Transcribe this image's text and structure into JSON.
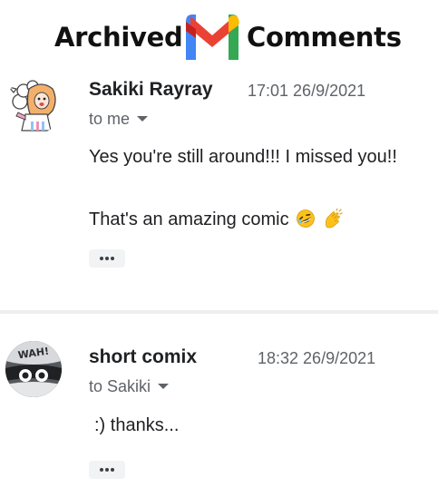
{
  "header": {
    "word_left": "Archived",
    "word_right": "Comments",
    "logo_icon": "gmail-m-logo",
    "logo_colors": [
      "#4285F4",
      "#EA4335",
      "#FBBC04",
      "#34A853",
      "#C5221F"
    ]
  },
  "messages": [
    {
      "sender": "Sakiki Rayray",
      "time": "17:01 26/9/2021",
      "recipient": "to me",
      "avatar_icon": "alpaca-with-hijab-avatar",
      "lines": [
        "Yes you're still around!!! I missed you!!",
        "That's an amazing comic"
      ],
      "emojis": [
        "rolling-on-floor-laughing-emoji",
        "clapping-hands-emoji"
      ]
    },
    {
      "sender": "short comix",
      "time": "18:32 26/9/2021",
      "recipient": "to Sakiki",
      "avatar_icon": "raccoon-mask-avatar",
      "avatar_text": "WAH!",
      "lines": [
        ":) thanks..."
      ]
    }
  ],
  "colors": {
    "sender_text": "#202124",
    "meta_text": "#5f6368",
    "more_button_bg": "#f1f3f4",
    "separator": "#eeeeee"
  }
}
